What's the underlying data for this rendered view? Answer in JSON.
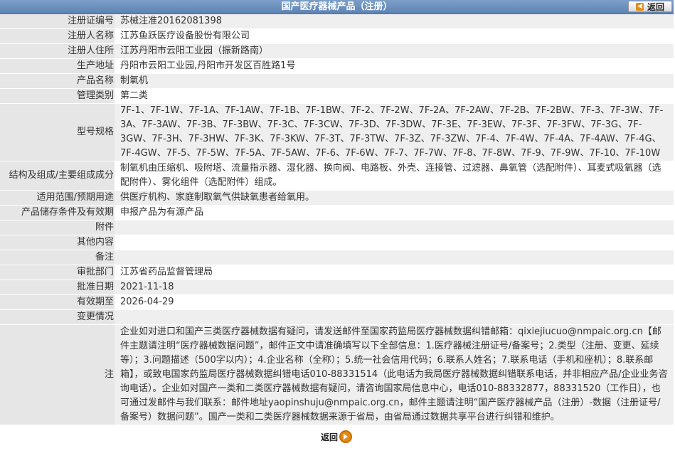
{
  "header": {
    "title": "国产医疗器械产品（注册）",
    "back_label": "返回"
  },
  "rows": [
    {
      "label": "注册证编号",
      "value": "苏械注准20162081398"
    },
    {
      "label": "注册人名称",
      "value": "江苏鱼跃医疗设备股份有限公司"
    },
    {
      "label": "注册人住所",
      "value": "江苏丹阳市云阳工业园（振新路南）"
    },
    {
      "label": "生产地址",
      "value": "丹阳市云阳工业园,丹阳市开发区百胜路1号"
    },
    {
      "label": "产品名称",
      "value": "制氧机"
    },
    {
      "label": "管理类别",
      "value": "第二类"
    },
    {
      "label": "型号规格",
      "value": "7F-1、7F-1W、7F-1A、7F-1AW、7F-1B、7F-1BW、7F-2、7F-2W、7F-2A、7F-2AW、7F-2B、7F-2BW、7F-3、7F-3W、7F-3A、7F-3AW、7F-3B、7F-3BW、7F-3C、7F-3CW、7F-3D、7F-3DW、7F-3E、7F-3EW、7F-3F、7F-3FW、7F-3G、7F-3GW、7F-3H、7F-3HW、7F-3K、7F-3KW、7F-3T、7F-3TW、7F-3Z、7F-3ZW、7F-4、7F-4W、7F-4A、7F-4AW、7F-4G、7F-4GW、7F-5、7F-5W、7F-5A、7F-5AW、7F-6、7F-6W、7F-7、7F-7W、7F-8、7F-8W、7F-9、7F-9W、7F-10、7F-10W"
    },
    {
      "label": "结构及组成/主要组成成分",
      "value": "制氧机由压缩机、吸附塔、流量指示器、湿化器、换向阀、电路板、外壳、连接管、过滤器、鼻氧管（选配附件）、耳麦式吸氧器（选配附件）、雾化组件（选配附件）组成。"
    },
    {
      "label": "适用范围/预期用途",
      "value": "供医疗机构、家庭制取氧气供缺氧患者给氧用。"
    },
    {
      "label": "产品储存条件及有效期",
      "value": "申报产品为有源产品"
    },
    {
      "label": "附件",
      "value": ""
    },
    {
      "label": "其他内容",
      "value": ""
    },
    {
      "label": "备注",
      "value": ""
    },
    {
      "label": "审批部门",
      "value": "江苏省药品监督管理局"
    },
    {
      "label": "批准日期",
      "value": "2021-11-18"
    },
    {
      "label": "有效期至",
      "value": "2026-04-29"
    },
    {
      "label": "变更情况",
      "value": ""
    }
  ],
  "note": {
    "label": "注",
    "text": "企业如对进口和国产三类医疗器械数据有疑问，请发送邮件至国家药监局医疗器械数据纠错邮箱：qixiejiucuo@nmpaic.org.cn【邮件主题请注明“医疗器械数据问题”，邮件正文中请准确填写以下全部信息：1.医疗器械注册证号/备案号；2.类型（注册、变更、延续等）；3.问题描述（500字以内）；4.企业名称（全称）；5.统一社会信用代码；6.联系人姓名；7.联系电话（手机和座机）；8.联系邮箱】，或致电国家药监局医疗器械数据纠错电话010-88331514（此电话为我局医疗器械数据纠错联系电话，并非相应产品/企业业务咨询电话）。企业如对国产一类和二类医疗器械数据有疑问，请咨询国家局信息中心，电话010-88332877，88331520（工作日），也可通过发邮件与我们联系：邮件地址yaopinshuju@nmpaic.org.cn，邮件主题请注明“国产医疗器械产品（注册）-数据（注册证号/备案号）数据问题”。国产一类和二类医疗器械数据来源于省局，由省局通过数据共享平台进行纠错和维护。"
  },
  "footer": {
    "back_label": "返回"
  }
}
